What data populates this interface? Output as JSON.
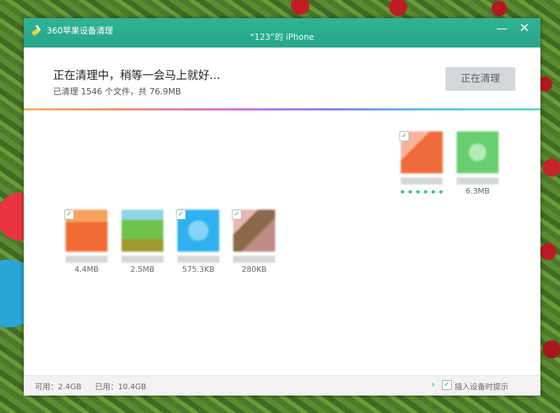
{
  "titlebar": {
    "app_name": "360苹果设备清理",
    "device_name": "“123”的 iPhone",
    "minimize_glyph": "—",
    "close_glyph": "✕"
  },
  "status": {
    "title": "正在清理中，稍等一会马上就好...",
    "subtitle": "已清理 1546 个文件，共 76.9MB",
    "button_label": "正在清理"
  },
  "files": [
    {
      "size": "",
      "color": "#f06b3b",
      "checked": true,
      "icon": "orange-app-icon",
      "progress_dots": 6
    },
    {
      "size": "6.3MB",
      "color": "#67cf6f",
      "checked": false,
      "icon": "green-app-icon"
    },
    {
      "size": "4.4MB",
      "color": "#f26a33",
      "checked": true,
      "icon": "orange-app-icon"
    },
    {
      "size": "2.5MB",
      "color": "#6fc24b",
      "checked": false,
      "icon": "green-game-icon"
    },
    {
      "size": "575.3KB",
      "color": "#2fb1ef",
      "checked": true,
      "icon": "blue-app-icon"
    },
    {
      "size": "280KB",
      "color": "#b97b6a",
      "checked": true,
      "icon": "brown-app-icon"
    }
  ],
  "footer": {
    "available": "可用：2.4GB",
    "used": "已用：10.4GB",
    "tip_label": "插入设备时提示",
    "tip_checked": true
  },
  "colors": {
    "accent": "#27a488",
    "button_bg": "#d5d8da"
  }
}
